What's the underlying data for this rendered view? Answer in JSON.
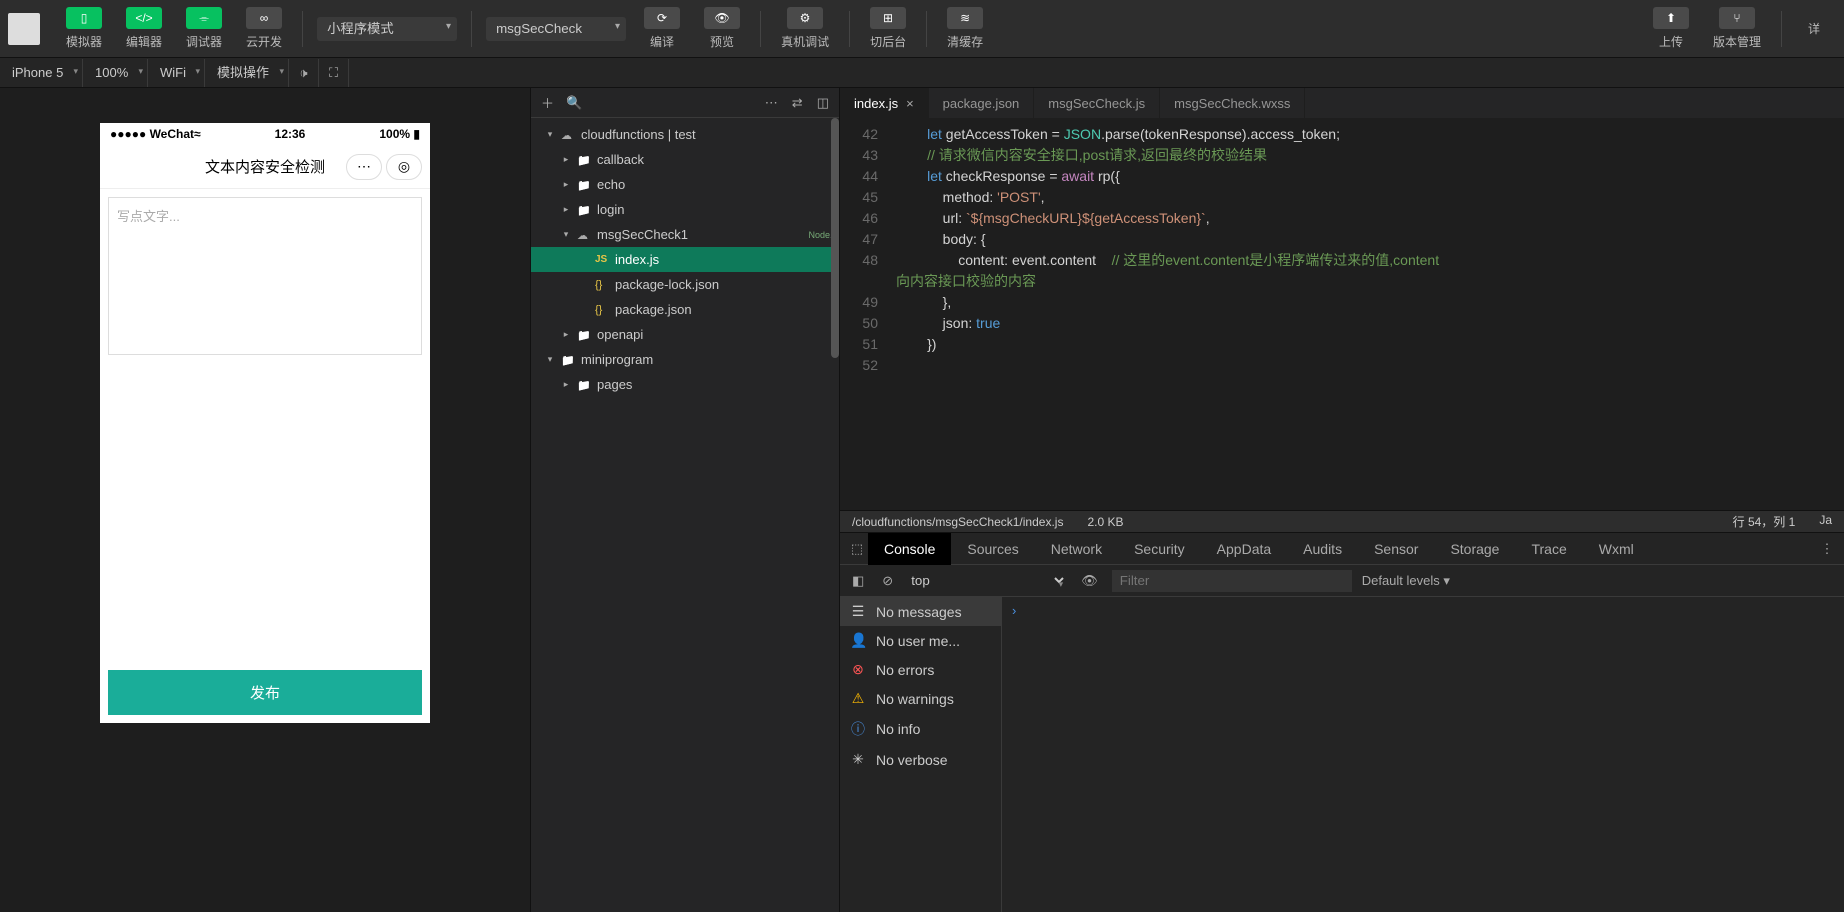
{
  "toolbar": {
    "simulator": "模拟器",
    "editor": "编辑器",
    "debugger": "调试器",
    "cloud_dev": "云开发",
    "mode_select": "小程序模式",
    "function_select": "msgSecCheck",
    "compile": "编译",
    "preview": "预览",
    "remote_debug": "真机调试",
    "background": "切后台",
    "clear_cache": "清缓存",
    "upload": "上传",
    "version": "版本管理",
    "details": "详"
  },
  "secbar": {
    "device": "iPhone 5",
    "zoom": "100%",
    "network": "WiFi",
    "mock_op": "模拟操作"
  },
  "phone": {
    "carrier": "●●●●● WeChat",
    "wifi_icon": "≈",
    "time": "12:36",
    "battery": "100%",
    "title": "文本内容安全检测",
    "placeholder": "写点文字...",
    "publish": "发布"
  },
  "tree": {
    "root": "cloudfunctions | test",
    "callback": "callback",
    "echo": "echo",
    "login": "login",
    "msgSecCheck1": "msgSecCheck1",
    "index_js": "index.js",
    "pkg_lock": "package-lock.json",
    "pkg": "package.json",
    "openapi": "openapi",
    "miniprogram": "miniprogram",
    "pages": "pages",
    "nodejs_badge": "Node.js"
  },
  "tabs": {
    "index": "index.js",
    "package": "package.json",
    "msgjs": "msgSecCheck.js",
    "msgwxss": "msgSecCheck.wxss"
  },
  "code": {
    "l42": {
      "n": "42",
      "pre": "        ",
      "let": "let",
      "rest": " getAccessToken = ",
      "json": "JSON",
      "rest2": ".parse(tokenResponse).access_token;"
    },
    "l43": {
      "n": "43",
      "pre": "        ",
      "cmt": "// 请求微信内容安全接口,post请求,返回最终的校验结果"
    },
    "l44": {
      "n": "44",
      "pre": "        ",
      "let": "let",
      "mid": " checkResponse = ",
      "await": "await",
      "rest": " rp({"
    },
    "l45": {
      "n": "45",
      "pre": "            method: ",
      "str": "'POST'",
      "tail": ","
    },
    "l46": {
      "n": "46",
      "pre": "            url: ",
      "tpl": "`${msgCheckURL}${getAccessToken}`",
      "tail": ","
    },
    "l47": {
      "n": "47",
      "pre": "            body: {"
    },
    "l48a": {
      "n": "48",
      "pre": "                content: event.content    ",
      "cmt": "// 这里的event.content是小程序端传过来的值,content"
    },
    "l48b": {
      "cmt2": "向内容接口校验的内容"
    },
    "l49": {
      "n": "49",
      "pre": "            },"
    },
    "l50": {
      "n": "50",
      "pre": "            json: ",
      "true": "true"
    },
    "l51": {
      "n": "51",
      "pre": "        })"
    },
    "l52": {
      "n": "52",
      "pre": ""
    }
  },
  "status": {
    "path": "/cloudfunctions/msgSecCheck1/index.js",
    "size": "2.0 KB",
    "pos": "行 54，列 1",
    "lang": "Ja"
  },
  "devtools": {
    "tabs": [
      "Console",
      "Sources",
      "Network",
      "Security",
      "AppData",
      "Audits",
      "Sensor",
      "Storage",
      "Trace",
      "Wxml"
    ],
    "context": "top",
    "filter_ph": "Filter",
    "levels": "Default levels ▾",
    "side": {
      "no_messages": "No messages",
      "no_user": "No user me...",
      "no_errors": "No errors",
      "no_warnings": "No warnings",
      "no_info": "No info",
      "no_verbose": "No verbose"
    },
    "prompt": "›"
  }
}
